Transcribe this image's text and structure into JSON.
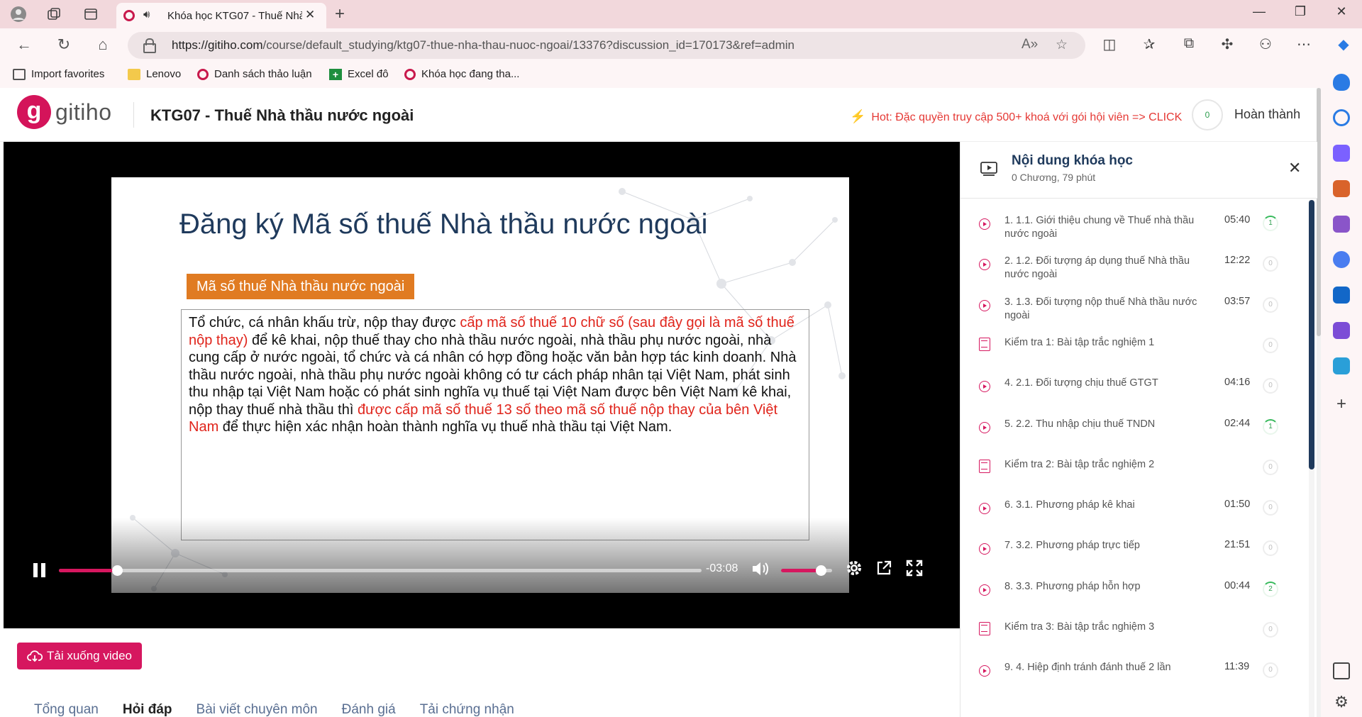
{
  "browser": {
    "tab_title": "Khóa học KTG07 - Thuế Nhà",
    "url_host": "https://gitiho.com",
    "url_path": "/course/default_studying/ktg07-thue-nha-thau-nuoc-ngoai/13376?discussion_id=170173&ref=admin",
    "favorites": [
      "Import favorites",
      "Lenovo",
      "Danh sách thảo luận",
      "Excel đô",
      "Khóa học đang tha..."
    ]
  },
  "header": {
    "logo_text": "gitiho",
    "course_title": "KTG07 - Thuế Nhà thầu nước ngoài",
    "hot_text": "Hot: Đặc quyền truy cập 500+ khoá với gói hội viên => CLICK",
    "progress": "0",
    "done_label": "Hoàn thành"
  },
  "slide": {
    "title": "Đăng ký Mã số thuế Nhà thầu nước ngoài",
    "badge": "Mã số thuế Nhà thầu nước ngoài",
    "p1": "Tổ chức, cá nhân khấu trừ, nộp thay được ",
    "r1": "cấp mã số thuế 10 chữ số (sau đây gọi là mã số thuế nộp thay)",
    "p2": " để kê khai, nộp thuế thay cho nhà thầu nước ngoài, nhà thầu phụ nước ngoài, nhà cung cấp ở nước ngoài, tổ chức và cá nhân có hợp đồng hoặc văn bản hợp tác kinh doanh. Nhà thầu nước ngoài, nhà thầu phụ nước ngoài không có tư cách pháp nhân tại Việt Nam, phát sinh thu nhập tại Việt Nam hoặc có phát sinh nghĩa vụ thuế tại Việt Nam được bên Việt Nam kê khai, nộp thay thuế nhà thầu thì ",
    "r2": "được cấp mã số thuế 13 số theo mã số thuế nộp thay của bên Việt Nam",
    "p3": " để thực hiện xác nhận hoàn thành nghĩa vụ thuế nhà thầu tại Việt Nam."
  },
  "player": {
    "time_remaining": "-03:08",
    "seek_progress": 0.09,
    "volume": 0.78,
    "accent": "#d6175f"
  },
  "download_label": "Tải xuống video",
  "page_tabs": [
    "Tổng quan",
    "Hỏi đáp",
    "Bài viết chuyên môn",
    "Đánh giá",
    "Tải chứng nhận"
  ],
  "active_tab": 1,
  "panel": {
    "title": "Nội dung khóa học",
    "subtitle": "0 Chương, 79 phút",
    "lessons": [
      {
        "type": "video",
        "title": "1. 1.1. Giới thiệu chung về Thuế nhà thầu nước ngoài",
        "duration": "05:40",
        "count": "1"
      },
      {
        "type": "video",
        "title": "2. 1.2. Đối tượng áp dụng thuế Nhà thầu nước ngoài",
        "duration": "12:22",
        "count": "0"
      },
      {
        "type": "video",
        "title": "3. 1.3. Đối tượng nộp thuế Nhà thầu nước ngoài",
        "duration": "03:57",
        "count": "0"
      },
      {
        "type": "quiz",
        "title": "Kiểm tra 1: Bài tập trắc nghiệm 1",
        "duration": "",
        "count": "0"
      },
      {
        "type": "video",
        "title": "4. 2.1. Đối tượng chịu thuế GTGT",
        "duration": "04:16",
        "count": "0"
      },
      {
        "type": "video",
        "title": "5. 2.2. Thu nhập chịu thuế TNDN",
        "duration": "02:44",
        "count": "1"
      },
      {
        "type": "quiz",
        "title": "Kiểm tra 2: Bài tập trắc nghiệm 2",
        "duration": "",
        "count": "0"
      },
      {
        "type": "video",
        "title": "6. 3.1. Phương pháp kê khai",
        "duration": "01:50",
        "count": "0"
      },
      {
        "type": "video",
        "title": "7. 3.2. Phương pháp trực tiếp",
        "duration": "21:51",
        "count": "0"
      },
      {
        "type": "video",
        "title": "8. 3.3. Phương pháp hỗn hợp",
        "duration": "00:44",
        "count": "2"
      },
      {
        "type": "quiz",
        "title": "Kiểm tra 3: Bài tập trắc nghiệm 3",
        "duration": "",
        "count": "0"
      },
      {
        "type": "video",
        "title": "9. 4. Hiệp định tránh đánh thuế 2 lần",
        "duration": "11:39",
        "count": "0"
      }
    ]
  }
}
